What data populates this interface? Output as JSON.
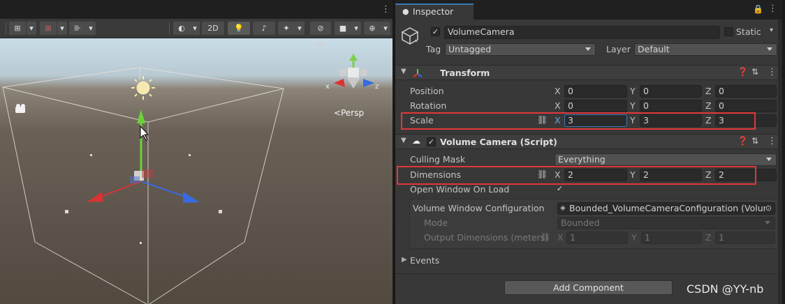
{
  "scene": {
    "toolbar": {
      "btn_2d": "2D"
    },
    "view_label": "Persp",
    "gizmo_x": "x",
    "gizmo_z": "z"
  },
  "inspector": {
    "tab_title": "Inspector",
    "object": {
      "name": "VolumeCamera",
      "active": true,
      "static_label": "Static",
      "tag_label": "Tag",
      "tag_value": "Untagged",
      "layer_label": "Layer",
      "layer_value": "Default"
    },
    "transform": {
      "title": "Transform",
      "position": {
        "label": "Position",
        "x": "0",
        "y": "0",
        "z": "0"
      },
      "rotation": {
        "label": "Rotation",
        "x": "0",
        "y": "0",
        "z": "0"
      },
      "scale": {
        "label": "Scale",
        "x": "3",
        "y": "3",
        "z": "3"
      }
    },
    "volume_camera": {
      "title": "Volume Camera (Script)",
      "culling_mask_label": "Culling Mask",
      "culling_mask_value": "Everything",
      "dimensions": {
        "label": "Dimensions",
        "x": "2",
        "y": "2",
        "z": "2"
      },
      "open_window_label": "Open Window On Load",
      "open_window_checked": true,
      "config_label": "Volume Window Configuration",
      "config_value": "Bounded_VolumeCameraConfiguration (Volum",
      "mode_label": "Mode",
      "mode_value": "Bounded",
      "output_label": "Output Dimensions (meters)",
      "output": {
        "x": "1",
        "y": "1",
        "z": "1"
      },
      "events_label": "Events"
    },
    "add_component": "Add Component",
    "axis_labels": {
      "x": "X",
      "y": "Y",
      "z": "Z"
    }
  },
  "watermark": "CSDN @YY-nb",
  "colors": {
    "highlight": "#e0383b",
    "accent": "#3a79bb"
  }
}
